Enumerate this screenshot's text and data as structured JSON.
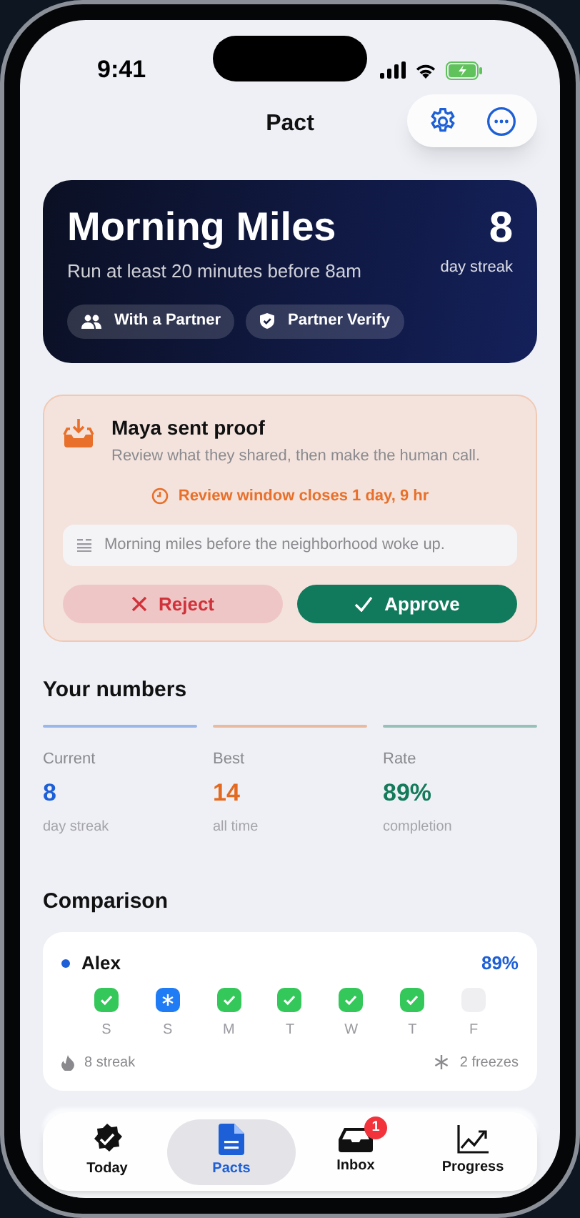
{
  "status_bar": {
    "time": "9:41"
  },
  "nav": {
    "title": "Pact"
  },
  "hero": {
    "title": "Morning Miles",
    "subtitle": "Run at least 20 minutes before 8am",
    "streak": "8",
    "streak_label": "day streak",
    "chips": [
      {
        "kind": "partner",
        "label": "With a Partner"
      },
      {
        "kind": "verify",
        "label": "Partner Verify"
      }
    ]
  },
  "proof": {
    "title": "Maya sent proof",
    "subtitle": "Review what they shared, then make the human call.",
    "deadline": "Review window closes 1 day, 9 hr",
    "note": "Morning miles before the neighborhood woke up.",
    "reject": "Reject",
    "approve": "Approve"
  },
  "numbers": {
    "title": "Your numbers",
    "stats": [
      {
        "label": "Current",
        "value": "8",
        "caption": "day streak",
        "color": "#1d5fd6"
      },
      {
        "label": "Best",
        "value": "14",
        "caption": "all time",
        "color": "#e46a1f"
      },
      {
        "label": "Rate",
        "value": "89%",
        "caption": "completion",
        "color": "#147a5a"
      }
    ]
  },
  "comparison": {
    "title": "Comparison",
    "person": {
      "name": "Alex",
      "color": "#1d5fd6",
      "rate": "89%",
      "days": [
        {
          "label": "S",
          "kind": "done"
        },
        {
          "label": "S",
          "kind": "freeze"
        },
        {
          "label": "M",
          "kind": "done"
        },
        {
          "label": "T",
          "kind": "done"
        },
        {
          "label": "W",
          "kind": "done"
        },
        {
          "label": "T",
          "kind": "done"
        },
        {
          "label": "F",
          "kind": "empty"
        }
      ],
      "streak": "8 streak",
      "freezes": "2 freezes"
    }
  },
  "tab_bar": [
    {
      "kind": "today",
      "label": "Today",
      "selected": false
    },
    {
      "kind": "pacts",
      "label": "Pacts",
      "selected": true
    },
    {
      "kind": "inbox",
      "label": "Inbox",
      "selected": false,
      "badge": "1"
    },
    {
      "kind": "progress",
      "label": "Progress",
      "selected": false
    }
  ]
}
